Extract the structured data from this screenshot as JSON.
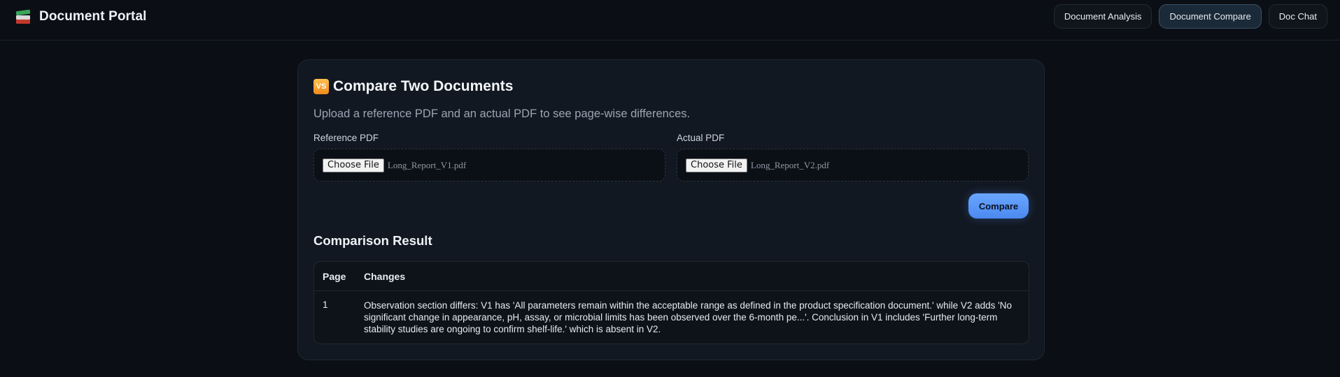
{
  "app": {
    "title": "Document Portal",
    "icon": "books-icon"
  },
  "nav": {
    "items": [
      {
        "label": "Document Analysis",
        "active": false
      },
      {
        "label": "Document Compare",
        "active": true
      },
      {
        "label": "Doc Chat",
        "active": false
      }
    ]
  },
  "compare": {
    "icon_text": "VS",
    "title": "Compare Two Documents",
    "subtitle": "Upload a reference PDF and an actual PDF to see page-wise differences.",
    "reference": {
      "label": "Reference PDF",
      "button_label": "Choose File",
      "file_name": "Long_Report_V1.pdf"
    },
    "actual": {
      "label": "Actual PDF",
      "button_label": "Choose File",
      "file_name": "Long_Report_V2.pdf"
    },
    "submit_label": "Compare"
  },
  "result": {
    "title": "Comparison Result",
    "columns": [
      "Page",
      "Changes"
    ],
    "rows": [
      {
        "page": "1",
        "changes": "Observation section differs: V1 has 'All parameters remain within the acceptable range as defined in the product specification document.' while V2 adds 'No significant change in appearance, pH, assay, or microbial limits has been observed over the 6-month pe...'. Conclusion in V1 includes 'Further long-term stability studies are ongoing to confirm shelf-life.' which is absent in V2."
      }
    ]
  },
  "colors": {
    "background": "#0b0f15",
    "card": "#121821",
    "accent": "#5b97f8",
    "active_nav": "#1b2a38"
  }
}
